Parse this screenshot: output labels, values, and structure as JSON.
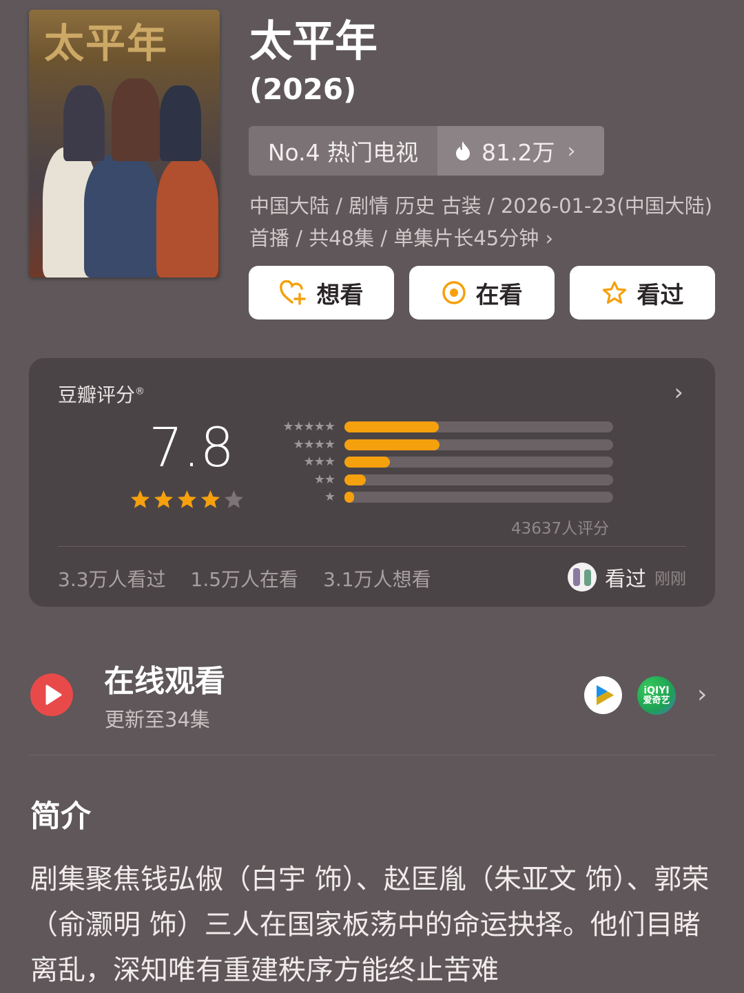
{
  "poster": {
    "title_text": "太平年"
  },
  "title": "太平年",
  "year": "(2026)",
  "rank": {
    "label": "No.4 热门电视",
    "heat": "81.2万"
  },
  "meta": "中国大陆 / 剧情 历史 古装 / 2026-01-23(中国大陆)首播 / 共48集 / 单集片长45分钟",
  "actions": [
    {
      "label": "想看",
      "icon": "heart-plus-icon"
    },
    {
      "label": "在看",
      "icon": "target-icon"
    },
    {
      "label": "看过",
      "icon": "star-outline-icon"
    }
  ],
  "rating": {
    "label": "豆瓣评分",
    "reg_mark": "®",
    "score": "7.8",
    "stars_filled": 4,
    "stars_total": 5,
    "distribution": [
      {
        "stars": 5,
        "fraction": 0.35
      },
      {
        "stars": 4,
        "fraction": 0.355
      },
      {
        "stars": 3,
        "fraction": 0.17
      },
      {
        "stars": 2,
        "fraction": 0.08
      },
      {
        "stars": 1,
        "fraction": 0.035
      }
    ],
    "count": "43637人评分",
    "watched": "3.3万人看过",
    "watching": "1.5万人在看",
    "want": "3.1万人想看",
    "user_status": "看过",
    "user_time": "刚刚"
  },
  "online": {
    "title": "在线观看",
    "subtitle": "更新至34集",
    "platform1": "tencent-video-icon",
    "platform2_line1": "iQIYI",
    "platform2_line2": "爱奇艺"
  },
  "intro": {
    "heading": "简介",
    "text": "剧集聚焦钱弘俶（白宇 饰）、赵匡胤（朱亚文 饰）、郭荣（俞灏明 饰）三人在国家板荡中的命运抉择。他们目睹离乱，深知唯有重建秩序方能终止苦难"
  },
  "colors": {
    "bg": "#5f5759",
    "accent": "#f5a00d",
    "card": "#4b4446"
  }
}
